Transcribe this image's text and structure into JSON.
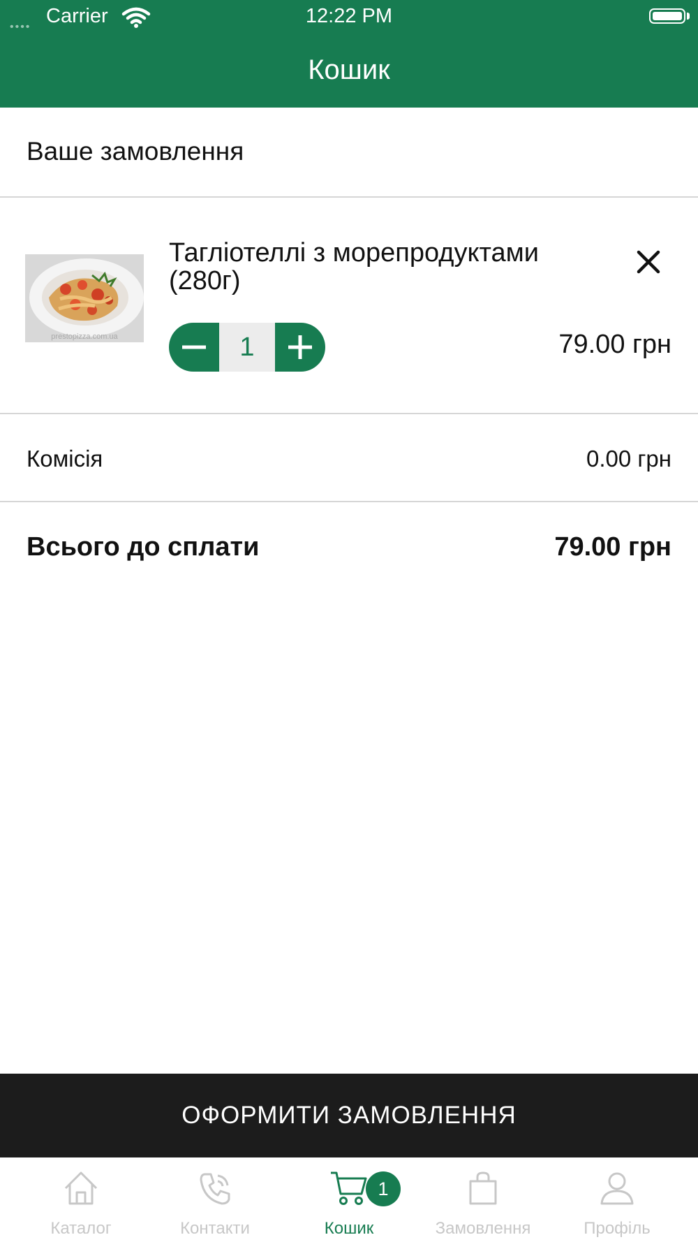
{
  "status_bar": {
    "carrier": "Carrier",
    "time": "12:22 PM"
  },
  "header": {
    "title": "Кошик"
  },
  "order": {
    "section_title": "Ваше замовлення",
    "items": [
      {
        "name": "Тагліотеллі з морепродуктами (280г)",
        "quantity": "1",
        "price": "79.00 грн",
        "image_watermark": "prestopizza.com.ua"
      }
    ]
  },
  "summary": {
    "commission_label": "Комісія",
    "commission_value": "0.00 грн",
    "total_label": "Всього до сплати",
    "total_value": "79.00 грн"
  },
  "checkout_button": "ОФОРМИТИ ЗАМОВЛЕННЯ",
  "tabbar": {
    "tabs": [
      {
        "label": "Каталог",
        "icon": "home-icon"
      },
      {
        "label": "Контакти",
        "icon": "phone-icon"
      },
      {
        "label": "Кошик",
        "icon": "cart-icon"
      },
      {
        "label": "Замовлення",
        "icon": "bag-icon"
      },
      {
        "label": "Профіль",
        "icon": "user-icon"
      }
    ],
    "active_tab": "Кошик",
    "cart_badge": "1"
  },
  "colors": {
    "brand_green": "#177C51",
    "checkout_bg": "#1c1c1c",
    "inactive_tab": "#c7c7c7"
  }
}
